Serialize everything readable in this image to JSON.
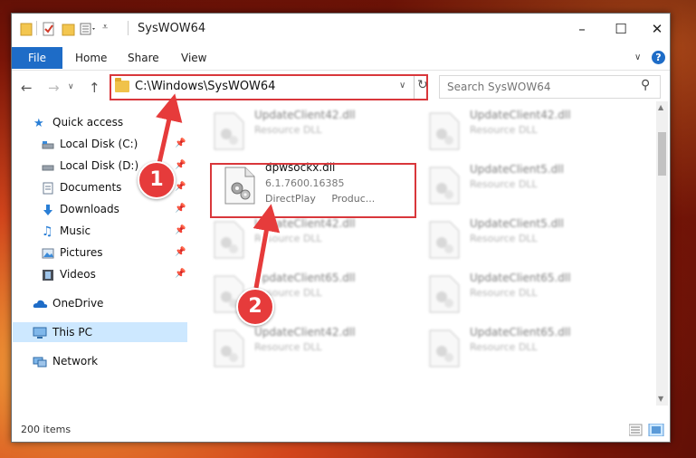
{
  "window": {
    "title": "SysWOW64"
  },
  "ribbon": {
    "file": "File",
    "home": "Home",
    "share": "Share",
    "view": "View"
  },
  "address": {
    "path": "C:\\Windows\\SysWOW64"
  },
  "search": {
    "placeholder": "Search SysWOW64"
  },
  "nav": {
    "items": [
      {
        "label": "Quick access",
        "icon": "star-icon"
      },
      {
        "label": "Local Disk (C:)",
        "icon": "drive-icon",
        "pinned": true
      },
      {
        "label": "Local Disk (D:)",
        "icon": "drive-icon",
        "pinned": true
      },
      {
        "label": "Documents",
        "icon": "documents-icon",
        "pinned": true
      },
      {
        "label": "Downloads",
        "icon": "downloads-icon",
        "pinned": true
      },
      {
        "label": "Music",
        "icon": "music-icon",
        "pinned": true
      },
      {
        "label": "Pictures",
        "icon": "pictures-icon",
        "pinned": true
      },
      {
        "label": "Videos",
        "icon": "videos-icon",
        "pinned": true
      },
      {
        "label": "OneDrive",
        "icon": "onedrive-icon"
      },
      {
        "label": "This PC",
        "icon": "pc-icon",
        "selected": true
      },
      {
        "label": "Network",
        "icon": "network-icon"
      }
    ]
  },
  "files": {
    "left": [
      {
        "name": "UpdateClient42.dll",
        "type": "Resource DLL"
      },
      {
        "name": "dpwsockx.dll",
        "version": "6.1.7600.16385",
        "desc": "DirectPlay     Produc..."
      },
      {
        "name": "UpdateClient42.dll",
        "type": "Resource DLL"
      },
      {
        "name": "UpdateClient65.dll",
        "type": "Resource DLL"
      },
      {
        "name": "UpdateClient42.dll",
        "type": "Resource DLL"
      }
    ],
    "right": [
      {
        "name": "UpdateClient42.dll",
        "type": "Resource DLL"
      },
      {
        "name": "UpdateClient5.dll",
        "type": "Resource DLL"
      },
      {
        "name": "UpdateClient5.dll",
        "type": "Resource DLL"
      },
      {
        "name": "UpdateClient65.dll",
        "type": "Resource DLL"
      },
      {
        "name": "UpdateClient65.dll",
        "type": "Resource DLL"
      }
    ]
  },
  "status": {
    "items": "200 items"
  },
  "annotations": {
    "one": "1",
    "two": "2"
  },
  "colors": {
    "accent": "#1e6cc7",
    "highlight": "#d9373b",
    "badge": "#e63b3b"
  }
}
